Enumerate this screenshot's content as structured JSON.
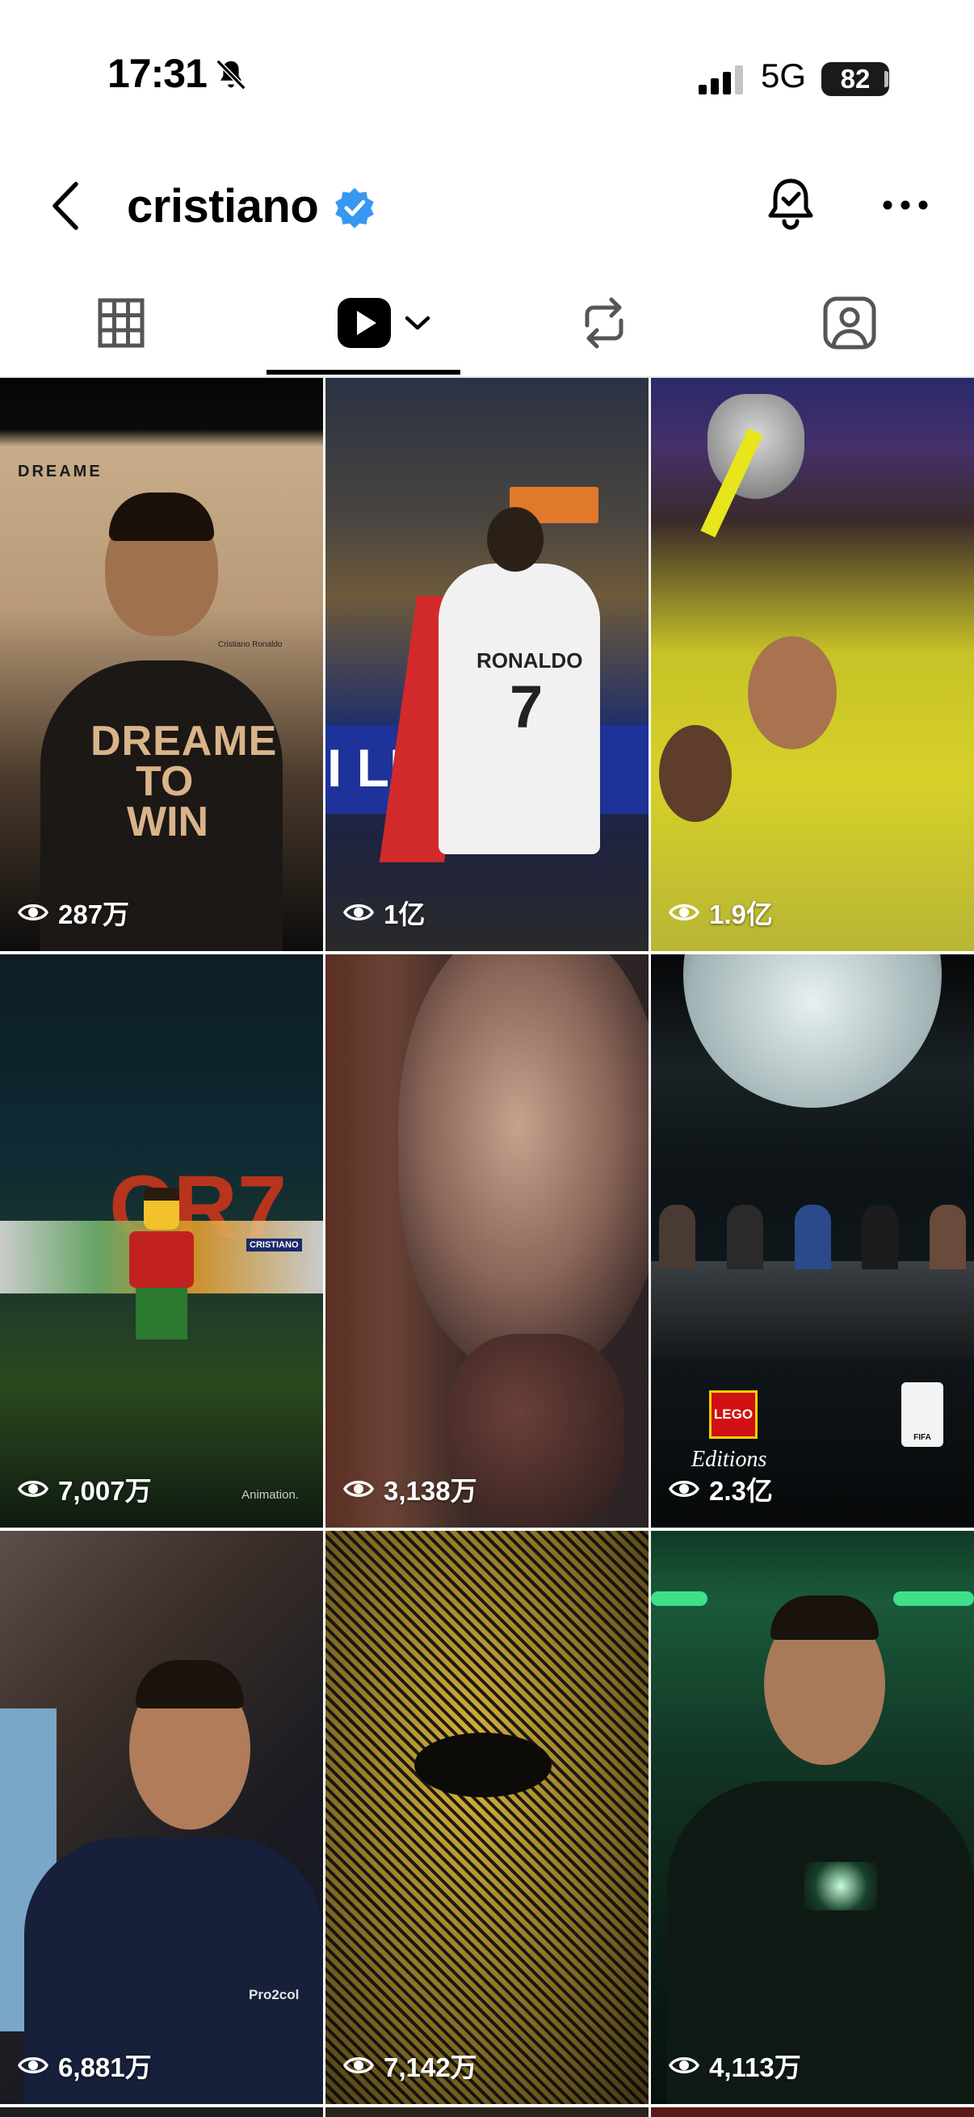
{
  "status_bar": {
    "time": "17:31",
    "network": "5G",
    "battery": "82"
  },
  "header": {
    "username": "cristiano"
  },
  "tabs": [
    {
      "name": "grid",
      "icon": "grid-icon"
    },
    {
      "name": "reels",
      "icon": "reels-icon",
      "selected": true
    },
    {
      "name": "reposts",
      "icon": "repost-icon"
    },
    {
      "name": "tagged",
      "icon": "tagged-icon"
    }
  ],
  "reels": [
    {
      "views": "287万",
      "brand_text": "DREAME",
      "slogan_line1": "DREAME",
      "slogan_line2": "TO",
      "slogan_line3": "WIN",
      "caption": "Cristiano Ronaldo"
    },
    {
      "views": "1亿",
      "jersey_name": "RONALDO",
      "jersey_number": "7",
      "banner_text": "I LEAG"
    },
    {
      "views": "1.9亿"
    },
    {
      "views": "7,007万",
      "corner_text": "Animation.",
      "sign_text": "CRISTIANO"
    },
    {
      "views": "3,138万"
    },
    {
      "views": "2.3亿",
      "logo_text": "LEGO",
      "logo_sub": "Editions",
      "fifa_text": "FIFA"
    },
    {
      "views": "6,881万",
      "shirt_text": "Pro2col"
    },
    {
      "views": "7,142万"
    },
    {
      "views": "4,113万"
    }
  ],
  "colors": {
    "verified_blue": "#3897f0",
    "text": "#000000",
    "divider": "#e6e6e6"
  }
}
